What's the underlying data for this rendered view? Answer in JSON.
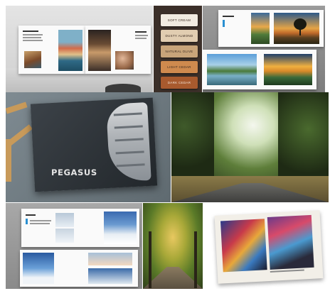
{
  "collage": {
    "tiles": [
      {
        "id": "travel-photobook",
        "kind": "photo"
      },
      {
        "id": "paper-swatches",
        "kind": "photo"
      },
      {
        "id": "landscape-photobook",
        "kind": "photo"
      },
      {
        "id": "pegasus-book",
        "kind": "photo"
      },
      {
        "id": "forest-road",
        "kind": "photo"
      },
      {
        "id": "winter-photobook",
        "kind": "photo"
      },
      {
        "id": "autumn-avenue",
        "kind": "photo"
      },
      {
        "id": "graffiti-photobook",
        "kind": "photo"
      }
    ]
  },
  "swatches": {
    "labels": [
      "SOFT CREAM",
      "DUSTY ALMOND",
      "NATURAL OLIVE",
      "LIGHT CEDAR",
      "DARK CEDAR"
    ],
    "colors": [
      "#f1ebe1",
      "#e1cdb1",
      "#c8a47a",
      "#cf8a4e",
      "#a85a2e"
    ]
  },
  "pegasus": {
    "title": "PEGASUS"
  }
}
